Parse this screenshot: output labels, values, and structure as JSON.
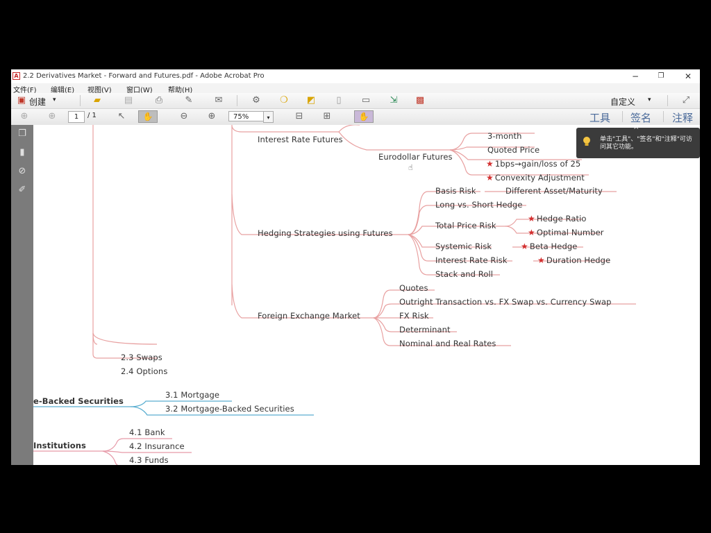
{
  "window": {
    "title": "2.2 Derivatives Market - Forward and Futures.pdf - Adobe Acrobat Pro",
    "app_icon": "acrobat-icon",
    "minimize": "−",
    "maximize": "❐",
    "close": "✕"
  },
  "menu": [
    "文件(F)",
    "编辑(E)",
    "视图(V)",
    "窗口(W)",
    "帮助(H)"
  ],
  "toolbar": {
    "create_label": "创建",
    "create_arrow": "▾",
    "customize_label": "自定义",
    "customize_arrow": "▾"
  },
  "nav": {
    "page_current": "1",
    "page_total": "/ 1",
    "zoom": "75%",
    "zoom_arrow": "▾",
    "right_tabs": [
      "工具",
      "签名",
      "注释"
    ]
  },
  "tooltip": {
    "text": "单击\"工具\"、\"签名\"和\"注释\"可访问其它功能。",
    "caret": "^"
  },
  "mindmap": {
    "top_fragment": "",
    "interest_rate_futures": "Interest Rate Futures",
    "eurodollar_futures": "Eurodollar Futures",
    "euro_children": [
      "3-month",
      "Quoted Price",
      "1bps→gain/loss of 25",
      "Convexity Adjustment"
    ],
    "euro_children_starred": [
      false,
      false,
      true,
      true
    ],
    "hedging": "Hedging Strategies using Futures",
    "basis_risk": "Basis Risk",
    "different_asset": "Different Asset/Maturity",
    "long_short": "Long vs. Short Hedge",
    "total_price_risk": "Total Price Risk",
    "hedge_ratio": "Hedge Ratio",
    "optimal_number": "Optimal Number",
    "systemic_risk": "Systemic Risk",
    "beta_hedge": "Beta Hedge",
    "interest_rate_risk": "Interest Rate Risk",
    "duration_hedge": "Duration Hedge",
    "stack_roll": "Stack and Roll",
    "fx_market": "Foreign Exchange Market",
    "fx_children": [
      "Quotes",
      "Outright Transaction vs. FX Swap vs. Currency Swap",
      "FX Risk",
      "Determinant",
      "Nominal and Real Rates"
    ],
    "swaps": "2.3 Swaps",
    "options": "2.4 Options",
    "mbs_parent": "e-Backed Securities",
    "mortgage": "3.1 Mortgage",
    "mbs": "3.2 Mortgage-Backed Securities",
    "institutions": "Institutions",
    "bank": "4.1 Bank",
    "insurance": "4.2 Insurance",
    "funds": "4.3 Funds",
    "star_glyph": "★"
  },
  "colors": {
    "branch_red": "#e8a0a0",
    "branch_blue": "#5aaed0",
    "branch_pink": "#e79aa8",
    "star": "#d32f2f",
    "sidebar": "#7b7b7b"
  }
}
